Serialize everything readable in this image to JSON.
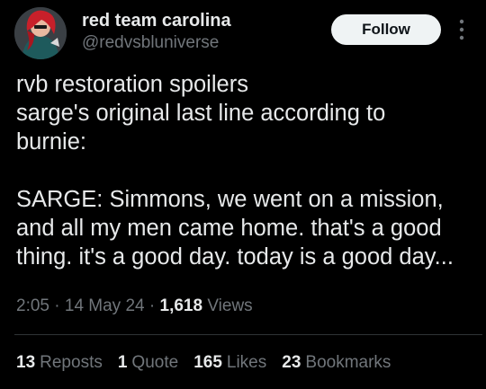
{
  "author": {
    "display_name": "red team carolina",
    "handle": "@redvsbluniverse"
  },
  "actions": {
    "follow_label": "Follow",
    "more_icon": "more-vertical-icon"
  },
  "tweet": {
    "text": "rvb restoration spoilers\nsarge's original last line according to\nburnie:\n\nSARGE: Simmons, we went on a mission,\nand all my men came home. that's a good\nthing. it's a good day. today is a good day..."
  },
  "meta": {
    "time": "2:05",
    "separator": " · ",
    "date": "14 May 24",
    "views_count": "1,618",
    "views_label": "Views"
  },
  "stats": [
    {
      "count": "13",
      "label": "Reposts"
    },
    {
      "count": "1",
      "label": "Quote"
    },
    {
      "count": "165",
      "label": "Likes"
    },
    {
      "count": "23",
      "label": "Bookmarks"
    }
  ],
  "colors": {
    "background": "#000000",
    "primary_text": "#e7e9ea",
    "secondary_text": "#71767b",
    "follow_button_bg": "#eff3f4",
    "divider": "#2f3336"
  }
}
